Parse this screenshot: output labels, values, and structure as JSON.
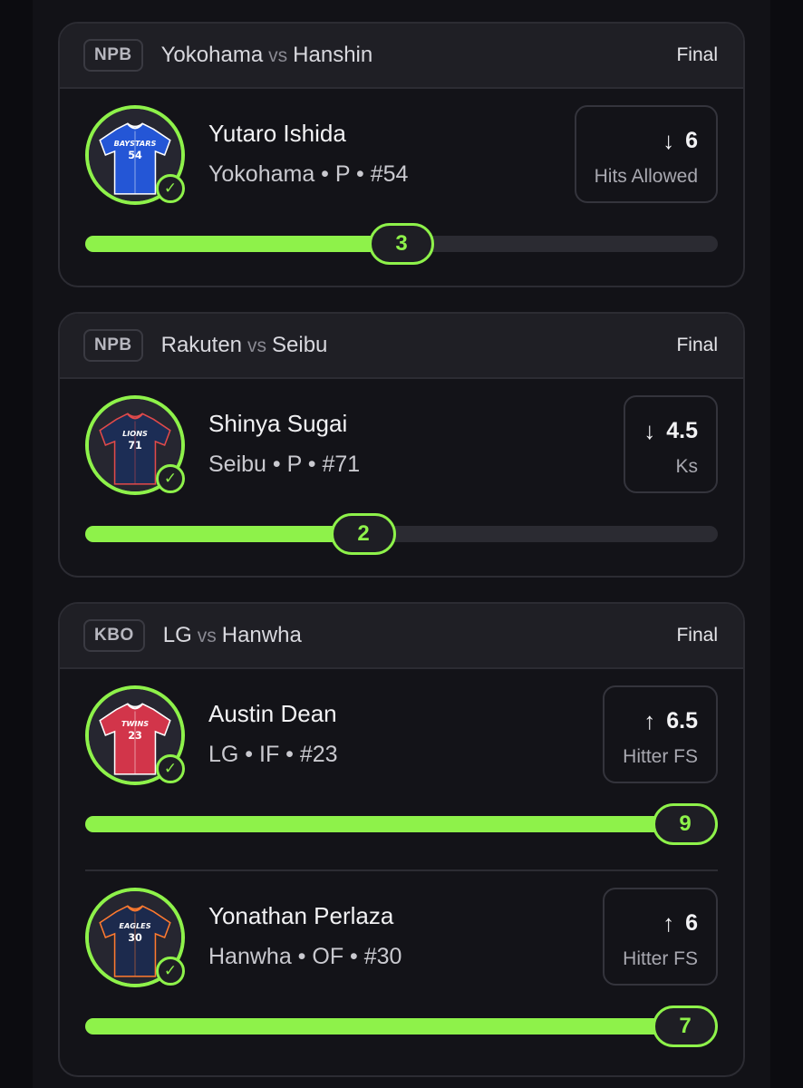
{
  "games": [
    {
      "league": "NPB",
      "home": "Yokohama",
      "vs": "vs",
      "away": "Hanshin",
      "status": "Final",
      "players": [
        {
          "name": "Yutaro Ishida",
          "meta": "Yokohama • P • #54",
          "jersey_text": "BAYSTARS",
          "jersey_number": "54",
          "jersey_color": "#2456d6",
          "jersey_trim": "#ffffff",
          "direction": "down",
          "arrow": "↓",
          "line": "6",
          "stat": "Hits Allowed",
          "result": "3",
          "progress": 0.5,
          "icon": "checkmark-icon"
        }
      ]
    },
    {
      "league": "NPB",
      "home": "Rakuten",
      "vs": "vs",
      "away": "Seibu",
      "status": "Final",
      "players": [
        {
          "name": "Shinya Sugai",
          "meta": "Seibu • P • #71",
          "jersey_text": "LIONS",
          "jersey_number": "71",
          "jersey_color": "#1c2d55",
          "jersey_trim": "#e24a4a",
          "direction": "down",
          "arrow": "↓",
          "line": "4.5",
          "stat": "Ks",
          "result": "2",
          "progress": 0.44,
          "icon": "checkmark-icon"
        }
      ]
    },
    {
      "league": "KBO",
      "home": "LG",
      "vs": "vs",
      "away": "Hanwha",
      "status": "Final",
      "players": [
        {
          "name": "Austin Dean",
          "meta": "LG • IF • #23",
          "jersey_text": "TWINS",
          "jersey_number": "23",
          "jersey_color": "#d2354a",
          "jersey_trim": "#ffffff",
          "direction": "up",
          "arrow": "↑",
          "line": "6.5",
          "stat": "Hitter FS",
          "result": "9",
          "progress": 0.95,
          "icon": "checkmark-icon"
        },
        {
          "name": "Yonathan Perlaza",
          "meta": "Hanwha • OF • #30",
          "jersey_text": "EAGLES",
          "jersey_number": "30",
          "jersey_color": "#1c2a4d",
          "jersey_trim": "#ff7a2f",
          "direction": "up",
          "arrow": "↑",
          "line": "6",
          "stat": "Hitter FS",
          "result": "7",
          "progress": 0.95,
          "icon": "checkmark-icon"
        }
      ]
    }
  ],
  "colors": {
    "accent": "#8ef24a",
    "card_bg": "#131318",
    "header_bg": "#1f1f25",
    "track_bg": "#2b2b32"
  }
}
